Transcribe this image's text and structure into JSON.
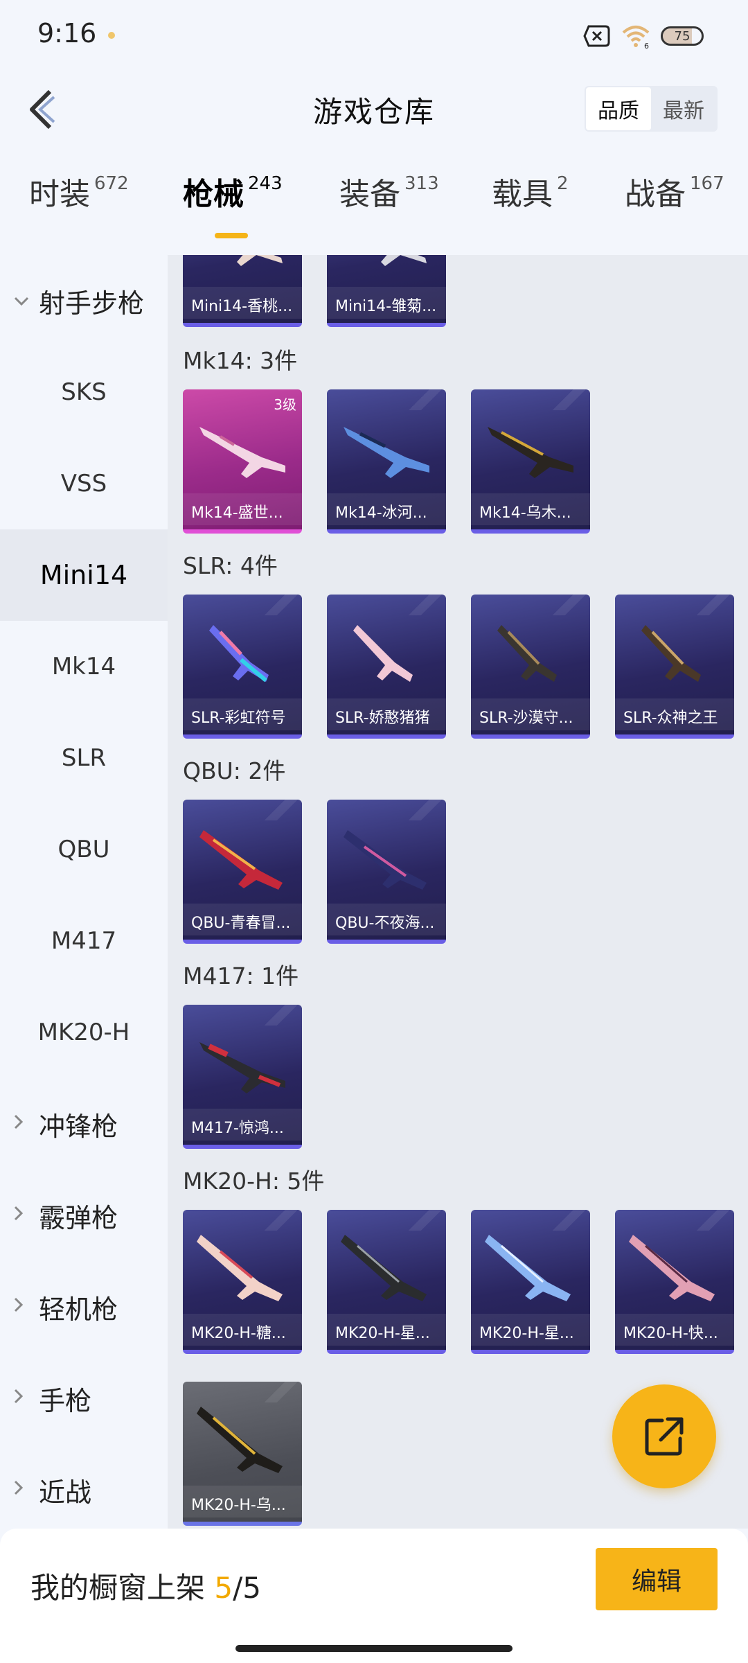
{
  "status": {
    "time": "9:16",
    "battery": "75",
    "battery_level": 0.75,
    "wifi_badge": "6"
  },
  "header": {
    "title": "游戏仓库",
    "sort_options": [
      "品质",
      "最新"
    ],
    "sort_selected": "品质"
  },
  "tabs": [
    {
      "label": "时装",
      "count": "672"
    },
    {
      "label": "枪械",
      "count": "243",
      "active": true
    },
    {
      "label": "装备",
      "count": "313"
    },
    {
      "label": "载具",
      "count": "2"
    },
    {
      "label": "战备",
      "count": "167"
    }
  ],
  "sidebar": {
    "group_expanded": "射手步枪",
    "sub_items": [
      "SKS",
      "VSS",
      "Mini14",
      "Mk14",
      "SLR",
      "QBU",
      "M417",
      "MK20-H"
    ],
    "active": "Mini14",
    "groups": [
      "冲锋枪",
      "霰弹枪",
      "轻机枪",
      "手枪",
      "近战"
    ]
  },
  "sections": {
    "mini14": {
      "items": [
        "Mini14-香桃...",
        "Mini14-雏菊..."
      ]
    },
    "mk14": {
      "title": "Mk14: 3件",
      "items": [
        "Mk14-盛世...",
        "Mk14-冰河...",
        "Mk14-乌木..."
      ],
      "badge": "3级"
    },
    "slr": {
      "title": "SLR: 4件",
      "items": [
        "SLR-彩虹符号",
        "SLR-娇憨猪猪",
        "SLR-沙漠守...",
        "SLR-众神之王"
      ]
    },
    "qbu": {
      "title": "QBU: 2件",
      "items": [
        "QBU-青春冒...",
        "QBU-不夜海..."
      ]
    },
    "m417": {
      "title": "M417: 1件",
      "items": [
        "M417-惊鸿..."
      ]
    },
    "mk20": {
      "title": "MK20-H: 5件",
      "items": [
        "MK20-H-糖...",
        "MK20-H-星...",
        "MK20-H-星...",
        "MK20-H-快...",
        "MK20-H-乌..."
      ]
    }
  },
  "bottom": {
    "shelf_label": "我的橱窗上架",
    "shelf_current": "5",
    "shelf_total": "/5",
    "edit_label": "编辑"
  },
  "colors": {
    "accent": "#f7b418",
    "card_purple": "#2a2660",
    "card_pink": "#9b2b8a",
    "card_grey": "#4d4f57"
  },
  "icons": {
    "back": "back-arrow-icon",
    "share": "share-external-icon",
    "expand": "chevron-down-icon",
    "collapse": "chevron-right-icon"
  }
}
